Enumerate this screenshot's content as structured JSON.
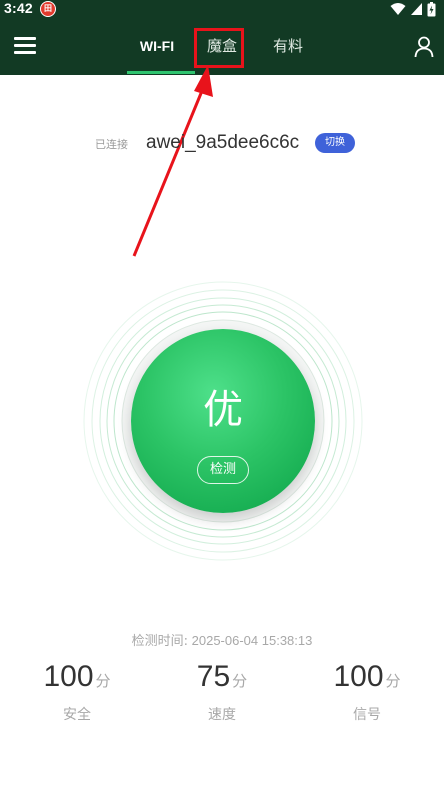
{
  "status_bar": {
    "time": "3:42",
    "notification_badge": "田",
    "icons": [
      "wifi-icon",
      "cellular-signal-icon",
      "battery-charging-icon"
    ]
  },
  "nav": {
    "menu_icon": "hamburger-menu-icon",
    "tabs": [
      {
        "label": "WI-FI",
        "active": true
      },
      {
        "label": "魔盒",
        "active": false,
        "highlighted": true
      },
      {
        "label": "有料",
        "active": false
      }
    ],
    "user_icon": "user-profile-icon"
  },
  "connection": {
    "status_label": "已连接",
    "ssid": "awei_9a5dee6c6c",
    "switch_label": "切换"
  },
  "score": {
    "grade": "优",
    "check_label": "检测"
  },
  "detection": {
    "time_label": "检测时间:",
    "time_value": "2025-06-04 15:38:13"
  },
  "stats": [
    {
      "value": "100",
      "unit": "分",
      "label": "安全"
    },
    {
      "value": "75",
      "unit": "分",
      "label": "速度"
    },
    {
      "value": "100",
      "unit": "分",
      "label": "信号"
    }
  ],
  "colors": {
    "header_bg": "#123a24",
    "accent_green": "#2cc466",
    "switch_blue": "#3f62d9",
    "annotation_red": "#e8131b"
  }
}
